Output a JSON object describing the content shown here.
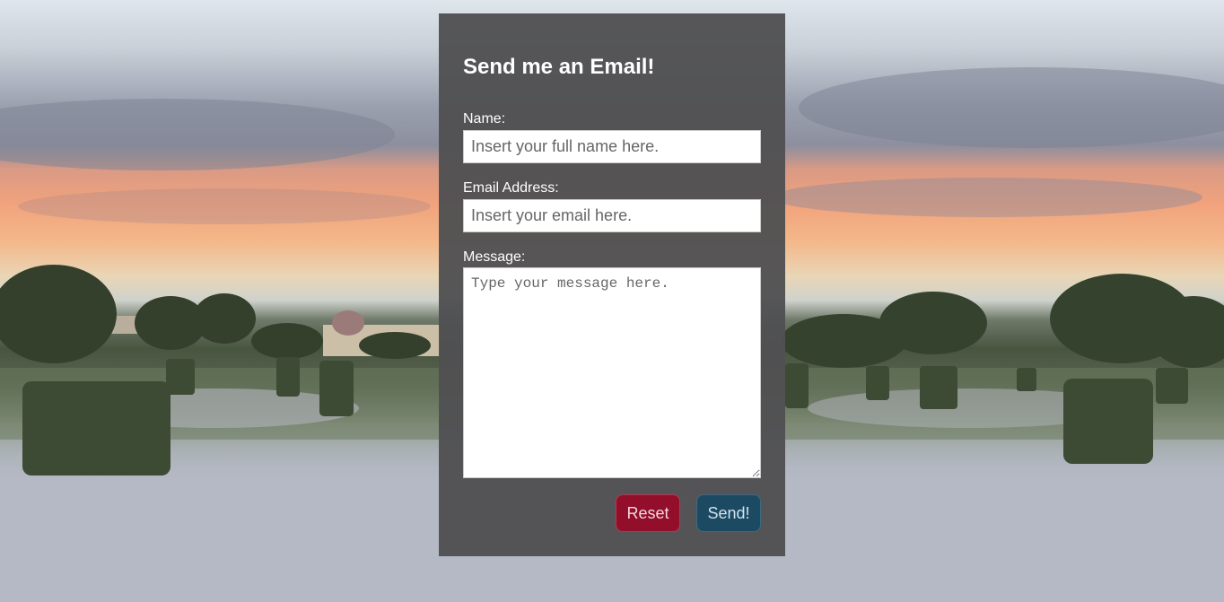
{
  "form": {
    "title": "Send me an Email!",
    "name_label": "Name:",
    "name_placeholder": "Insert your full name here.",
    "email_label": "Email Address:",
    "email_placeholder": "Insert your email here.",
    "message_label": "Message:",
    "message_placeholder": "Type your message here.",
    "reset_label": "Reset",
    "send_label": "Send!"
  },
  "colors": {
    "page_background": "#b4b9c5",
    "card_background": "#505052",
    "reset_button": "#920e2a",
    "send_button": "#1c4a63"
  }
}
